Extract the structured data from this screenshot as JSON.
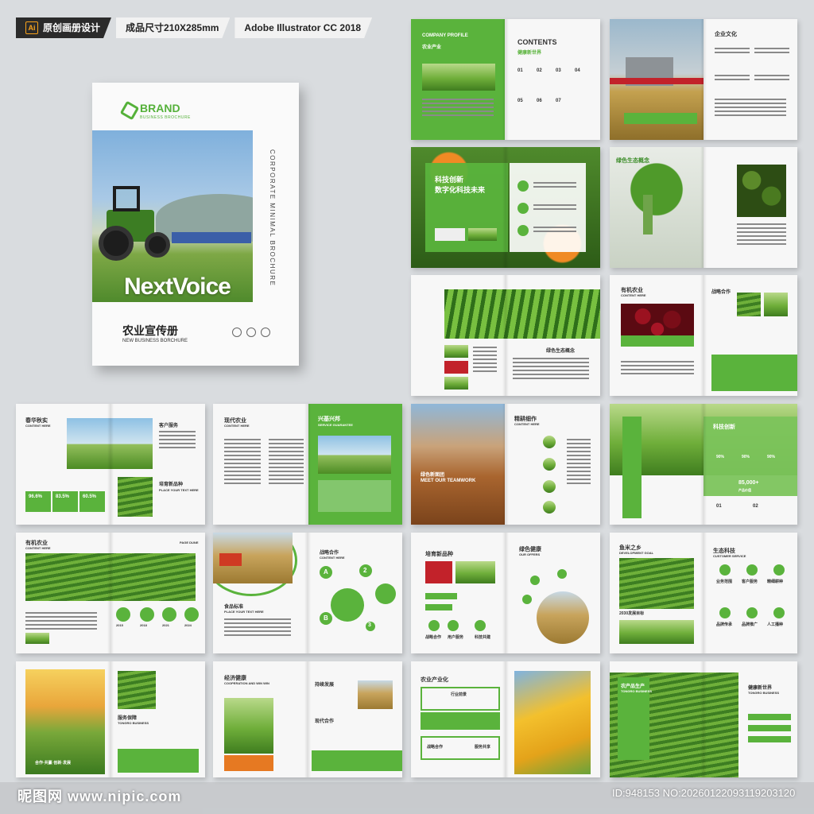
{
  "labels": {
    "ai": "Ai",
    "design": "原创画册设计",
    "size": "成品尺寸210X285mm",
    "software": "Adobe Illustrator CC 2018"
  },
  "cover": {
    "brand": "BRAND",
    "brand_sub": "BUSINESS BROCHURE",
    "vertical": "CORPORATE MINIMAL BROCHURE",
    "logo_text": "NextVoice",
    "title": "农业宣传册",
    "subtitle": "NEW BUSINESS BORCHURE"
  },
  "spreads": {
    "s1": {
      "title": "CONTENTS",
      "sub": "健康新世界",
      "left_label": "COMPANY PROFILE",
      "left_cn": "农业产业",
      "nums": [
        "01",
        "02",
        "03",
        "04",
        "05",
        "06",
        "07"
      ]
    },
    "s2": {
      "title": "企业文化"
    },
    "s3": {
      "title": "科技创新",
      "title2": "数字化科技未来"
    },
    "s4": {
      "title": "绿色生态概念"
    },
    "s5": {
      "title": "绿色生态概念"
    },
    "s6": {
      "title": "有机农业",
      "sub": "CONTENT HERE",
      "right": "战略合作"
    },
    "s7": {
      "title": "春华秋实",
      "sub": "CONTENT HERE",
      "right": "客户服务",
      "right2": "培育新品种",
      "right2_sub": "PLACE YOUR TEXT HERE",
      "stats": [
        "96.6%",
        "83.5%",
        "60.5%"
      ]
    },
    "s8": {
      "title": "现代农业",
      "sub": "CONTENT HERE",
      "right": "兴基兴邦",
      "right_sub": "SERVICE GUARANTEE"
    },
    "s9": {
      "title": "精耕细作",
      "sub": "CONTENT HERE",
      "left": "绿色新面团",
      "left_sub": "MEET OUR TEAMWORK"
    },
    "s10": {
      "title": "科技创新",
      "stat1": "90%",
      "stat2": "90%",
      "stat3": "90%",
      "big": "85,000+",
      "big_label": "产品价值",
      "nums": [
        "01",
        "02"
      ]
    },
    "s11": {
      "title": "有机农业",
      "sub": "CONTENT HERE",
      "badge": "PAGE DUNE",
      "circles": [
        "2015",
        "2018",
        "2021",
        "2024"
      ]
    },
    "s12": {
      "title": "战略合作",
      "sub": "CONTENT HERE",
      "left": "食品标准",
      "left_sub": "PLACE YOUR TEXT HERE",
      "nodes": [
        "A",
        "B",
        "1",
        "2",
        "3"
      ]
    },
    "s13": {
      "title": "培育新品种",
      "right": "绿色健康",
      "right_sub": "OUR OFFERS",
      "items": [
        "战略合作",
        "用户服务",
        "科技共建"
      ]
    },
    "s14": {
      "title": "鱼米之乡",
      "sub": "DEVELOPMENT GOAL",
      "right": "生态科技",
      "right_sub": "CUSTOMER SERVICE",
      "year": "2030发展目标",
      "cells": [
        "业务范围",
        "客户服务",
        "精细耕种",
        "品牌传承",
        "品牌推广",
        "人工播种"
      ]
    },
    "s15": {
      "left": "合作·共赢·创新·发展",
      "right": "服务保障",
      "right_sub": "TONGRO BUSINESS"
    },
    "s16": {
      "title": "经济健康",
      "sub": "COOPERATION AND WIN WIN",
      "right": "持续发展",
      "mid": "现代合作"
    },
    "s17": {
      "title": "农业产业化",
      "items": [
        "战略合作",
        "行业前景",
        "服务共享"
      ]
    },
    "s18": {
      "left": "农产品生产",
      "left_sub": "TONGRO BUSINESS",
      "right": "健康新世界",
      "right_sub": "TONGRO BUSINESS"
    }
  },
  "watermark": {
    "left": "昵图网 www.nipic.com",
    "right": "ID:948153 NO:20260122093119203120"
  },
  "colors": {
    "accent": "#5ab33c",
    "dark": "#2b2b2b",
    "background": "#d9dcdf"
  }
}
